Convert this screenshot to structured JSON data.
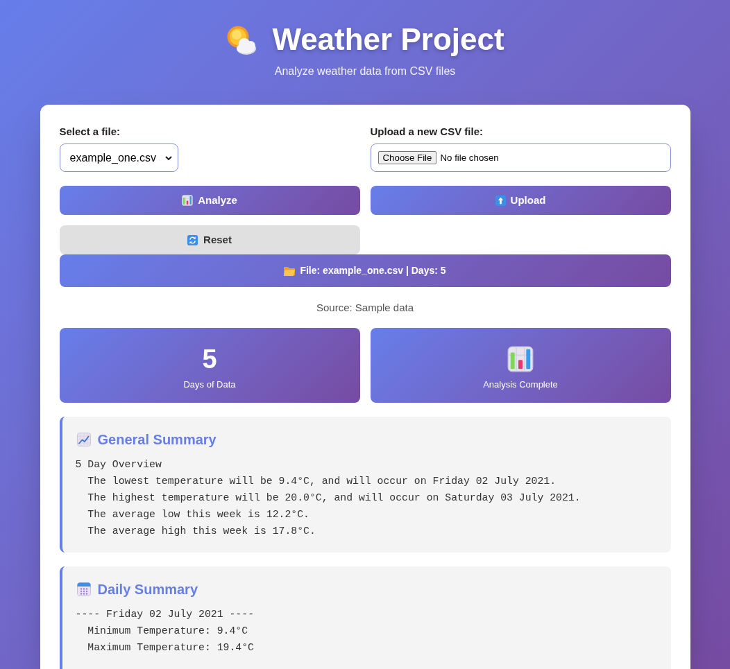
{
  "header": {
    "title": "Weather Project",
    "subtitle": "Analyze weather data from CSV files"
  },
  "file_select": {
    "label": "Select a file:",
    "value": "example_one.csv"
  },
  "file_upload": {
    "label": "Upload a new CSV file:",
    "button": "Choose File",
    "status": "No file chosen"
  },
  "analyze_button": "Analyze",
  "upload_button": "Upload",
  "reset_button": "Reset",
  "file_info": "File: example_one.csv | Days: 5",
  "source": "Source: Sample data",
  "days_stat": {
    "value": "5",
    "label": "Days of Data"
  },
  "analysis_stat": {
    "label": "Analysis Complete"
  },
  "general_summary": {
    "title": "General Summary",
    "lines": [
      {
        "text": "5 Day Overview",
        "children": [
          {
            "text": "The lowest temperature will be 9.4°C, and will occur on Friday 02 July 2021."
          },
          {
            "text": "The highest temperature will be 20.0°C, and will occur on Saturday 03 July 2021."
          },
          {
            "text": "The average low this week is 12.2°C."
          },
          {
            "text": "The average high this week is 17.8°C."
          }
        ]
      }
    ]
  },
  "daily_summary": {
    "title": "Daily Summary",
    "lines": [
      {
        "text": "---- Friday 02 July 2021 ----",
        "children": [
          {
            "text": "Minimum Temperature: 9.4°C"
          },
          {
            "text": "Maximum Temperature: 19.4°C"
          }
        ]
      }
    ]
  }
}
